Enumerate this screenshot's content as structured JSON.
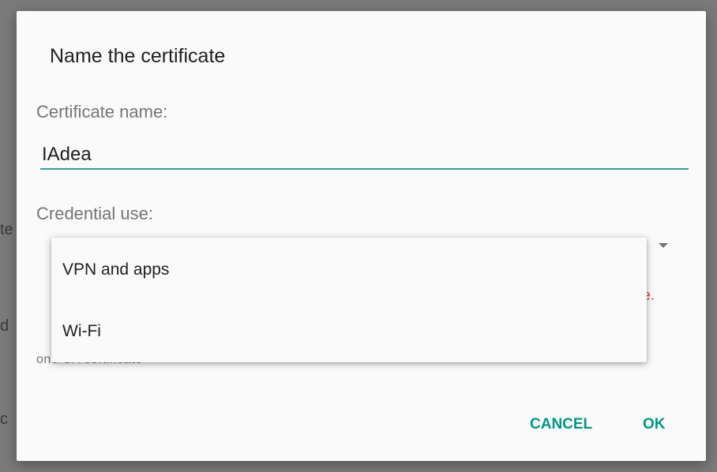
{
  "background": {
    "fragments": [
      "te",
      "d",
      "c"
    ]
  },
  "dialog": {
    "title": "Name the certificate",
    "certificate_label": "Certificate name:",
    "certificate_value": "IAdea",
    "credential_label": "Credential use:",
    "error_text_fragment": "ice.",
    "ca_text": "one CA certificate",
    "cancel_label": "CANCEL",
    "ok_label": "OK"
  },
  "dropdown": {
    "options": [
      "VPN and apps",
      "Wi-Fi"
    ]
  },
  "colors": {
    "accent": "#009688",
    "underline": "#26a69a",
    "error": "#e53935"
  },
  "icons": {
    "dropdown": "triangle-down-icon"
  }
}
